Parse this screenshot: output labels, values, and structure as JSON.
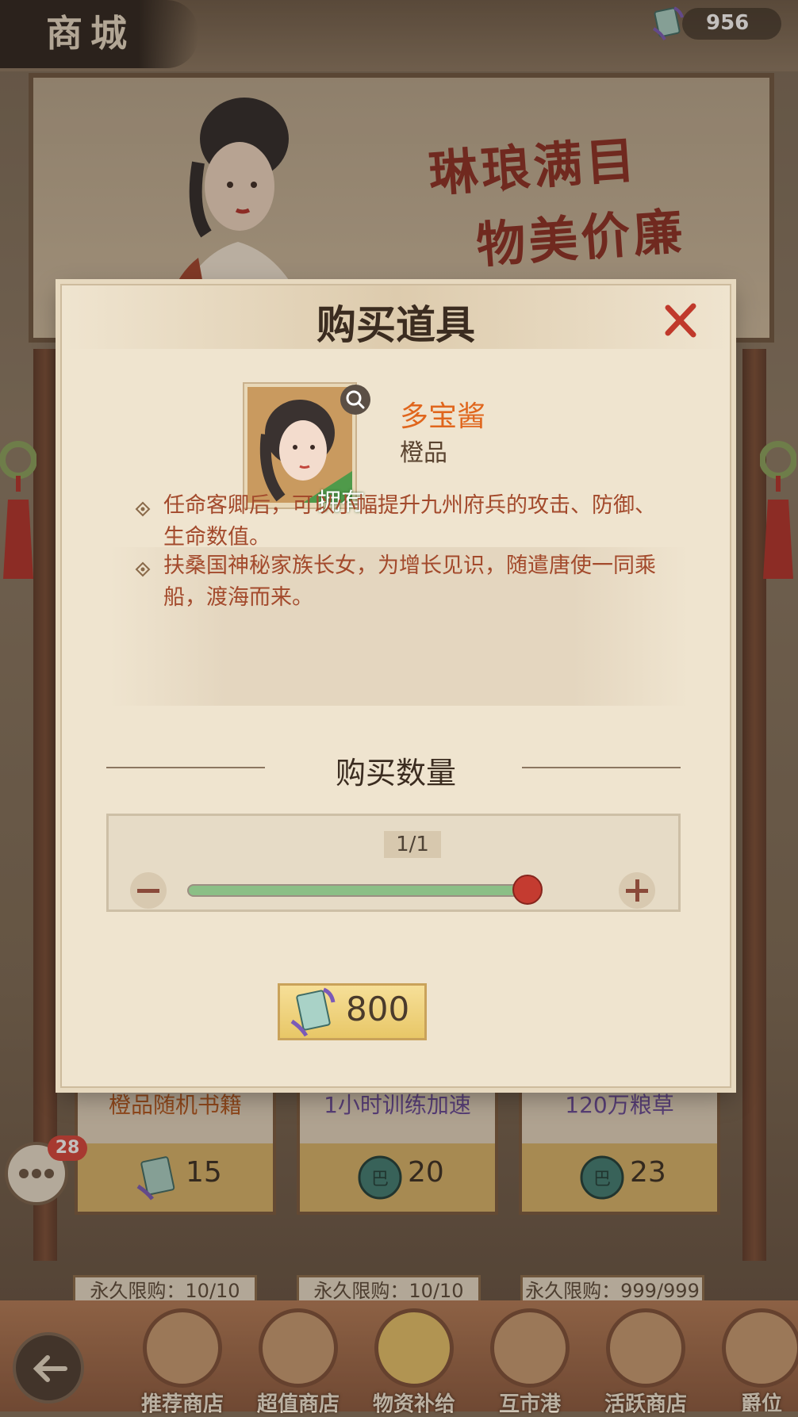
{
  "header": {
    "title": "商城",
    "currency_amount": "956"
  },
  "banner": {
    "slogan_line1": "琳琅满目",
    "slogan_line2": "物美价廉"
  },
  "shop_cards": [
    {
      "name": "橙品随机书籍",
      "price": "15",
      "name_color": "#b7591f",
      "currency_icon": "book-token-icon"
    },
    {
      "name": "1小时训练加速",
      "price": "20",
      "name_color": "#6a4b9c",
      "currency_icon": "jade-coin-icon"
    },
    {
      "name": "120万粮草",
      "price": "23",
      "name_color": "#6a4b9c",
      "currency_icon": "jade-coin-icon"
    }
  ],
  "limits": [
    "永久限购：10/10",
    "永久限购：10/10",
    "永久限购：999/999"
  ],
  "chat": {
    "badge_count": "28"
  },
  "bottom_nav": [
    {
      "label": "推荐商店"
    },
    {
      "label": "超值商店"
    },
    {
      "label": "物资补给"
    },
    {
      "label": "互市港"
    },
    {
      "label": "活跃商店"
    },
    {
      "label": "爵位"
    }
  ],
  "dialog": {
    "title": "购买道具",
    "item": {
      "name": "多宝酱",
      "grade": "橙品",
      "owned_label": "拥有"
    },
    "descriptions": [
      "任命客卿后，可以小幅提升九州府兵的攻击、防御、生命数值。",
      "扶桑国神秘家族长女，为增长见识，随遣唐使一同乘船，渡海而来。"
    ],
    "quantity": {
      "title": "购买数量",
      "readout": "1/1",
      "fraction": 1.0
    },
    "buy": {
      "price": "800"
    }
  },
  "colors": {
    "accent_orange": "#e0661d",
    "close_red": "#c0392b",
    "slider_fill": "#8bbf86",
    "slider_thumb": "#c43b30"
  }
}
